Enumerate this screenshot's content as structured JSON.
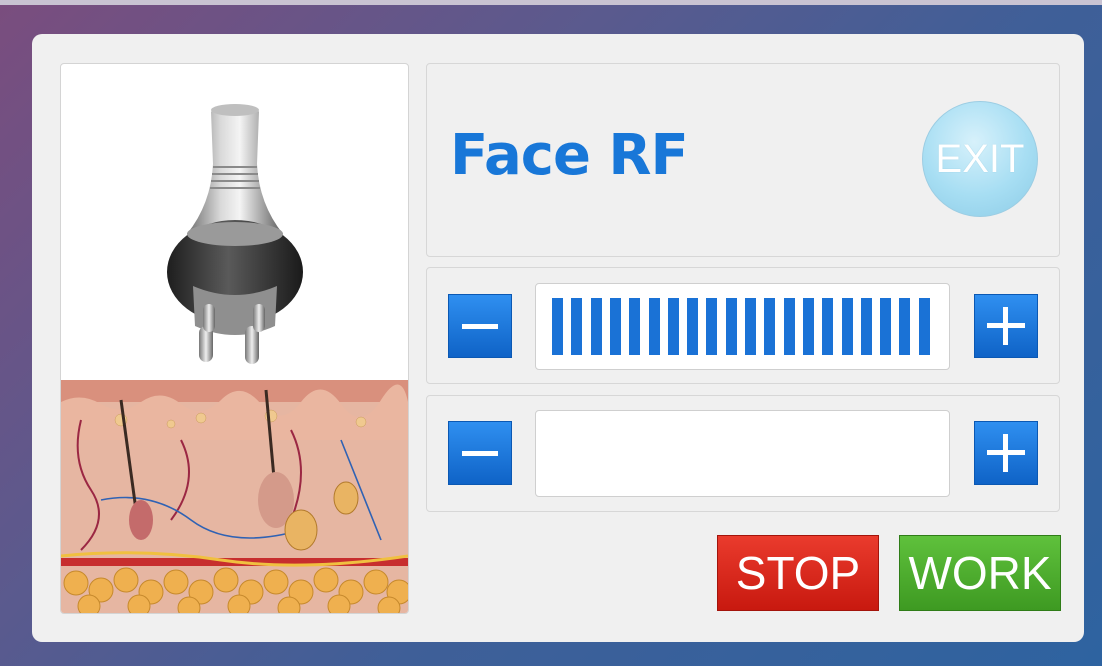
{
  "window": {
    "title": "Face RF"
  },
  "header": {
    "title": "Face RF",
    "exit_label": "EXIT"
  },
  "controls": {
    "row1": {
      "minus_icon": "minus-icon",
      "plus_icon": "plus-icon",
      "level_segments": 20,
      "level_max": 20
    },
    "row2": {
      "minus_icon": "minus-icon",
      "plus_icon": "plus-icon",
      "level_segments": 0,
      "level_max": 20
    }
  },
  "actions": {
    "stop_label": "STOP",
    "work_label": "WORK"
  },
  "images": {
    "handpiece": "rf-handpiece-image",
    "skin": "skin-cross-section-image"
  },
  "colors": {
    "accent": "#1877d8",
    "button_blue": "#1a72d6",
    "stop_red": "#d9281c",
    "work_green": "#4cae2c",
    "exit_cyan": "#a7def3"
  }
}
